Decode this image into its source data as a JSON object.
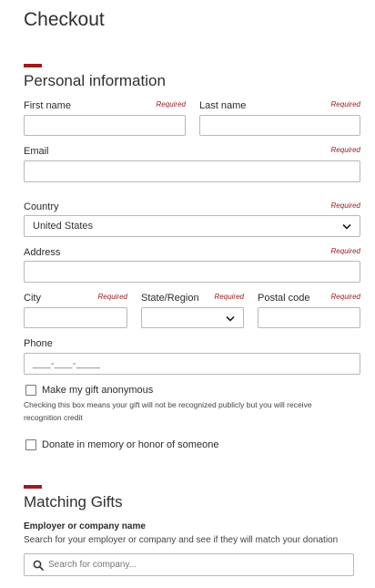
{
  "page": {
    "title": "Checkout"
  },
  "personal": {
    "title": "Personal information",
    "required": "Required",
    "first_name_label": "First name",
    "last_name_label": "Last name",
    "email_label": "Email",
    "country_label": "Country",
    "country_value": "United States",
    "address_label": "Address",
    "city_label": "City",
    "state_label": "State/Region",
    "postal_label": "Postal code",
    "phone_label": "Phone",
    "phone_mask": "___-___-____",
    "anonymous_label": "Make my gift anonymous",
    "anonymous_help": "Checking this box means your gift will not be recognized publicly but you will receive recognition credit",
    "memory_label": "Donate in memory or honor of someone"
  },
  "matching": {
    "title": "Matching Gifts",
    "employer_label": "Employer or company name",
    "employer_help": "Search for your employer or company and see if they will match your donation",
    "search_placeholder": "Search for company..."
  },
  "colors": {
    "accent": "#9e1b22",
    "border": "#b8b8b8"
  },
  "icons": {
    "dropdown": "chevron-down-icon",
    "search": "search-icon"
  }
}
